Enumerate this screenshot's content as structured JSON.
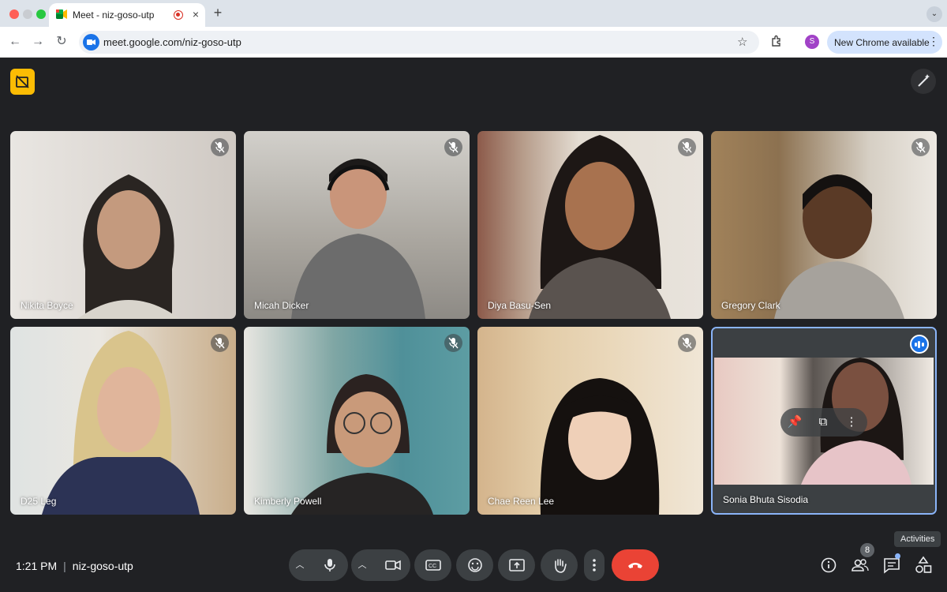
{
  "browser": {
    "tab_title": "Meet - niz-goso-utp",
    "tab_close": "×",
    "new_tab": "+",
    "url": "meet.google.com/niz-goso-utp",
    "update_label": "New Chrome available",
    "profile_initial": "S"
  },
  "participants": [
    {
      "name": "Nikita Boyce",
      "muted": true
    },
    {
      "name": "Micah Dicker",
      "muted": true
    },
    {
      "name": "Diya Basu-Sen",
      "muted": true
    },
    {
      "name": "Gregory Clark",
      "muted": true
    },
    {
      "name": "D25 Leg",
      "muted": true
    },
    {
      "name": "Kimberly Powell",
      "muted": true
    },
    {
      "name": "Chae Reen Lee",
      "muted": true
    },
    {
      "name": "Sonia Bhuta Sisodia",
      "muted": false,
      "speaking": true
    }
  ],
  "footer": {
    "time": "1:21 PM",
    "meeting_code": "niz-goso-utp",
    "people_count": "8",
    "activities_tooltip": "Activities"
  },
  "colors": {
    "stage_bg": "#202124",
    "end_call": "#ea4335",
    "accent": "#8ab4f8",
    "host_controls": "#fbbc04"
  }
}
